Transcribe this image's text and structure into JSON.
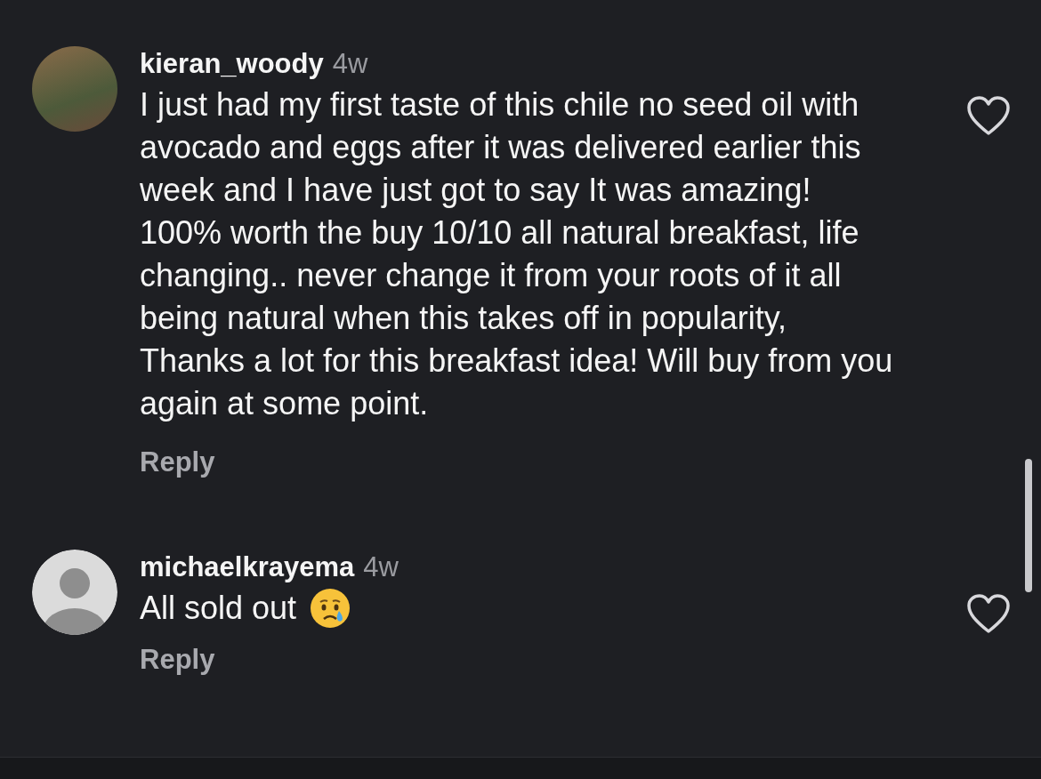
{
  "comments": [
    {
      "kind": "photo",
      "username": "kieran_woody",
      "time": "4w",
      "text": "I just had my first taste of this chile no seed oil with avocado and eggs after it was delivered earlier this week and I have just got to say It was amazing! 100% worth the buy 10/10 all natural breakfast, life changing.. never change it from your roots of it all being natural when this takes off in popularity, Thanks a lot for this breakfast idea! Will buy from you again at some point.",
      "emoji": false,
      "reply": "Reply",
      "liked": false
    },
    {
      "kind": "default",
      "username": "michaelkrayema",
      "time": "4w",
      "text": "All sold out",
      "emoji": true,
      "reply": "Reply",
      "liked": false
    }
  ]
}
